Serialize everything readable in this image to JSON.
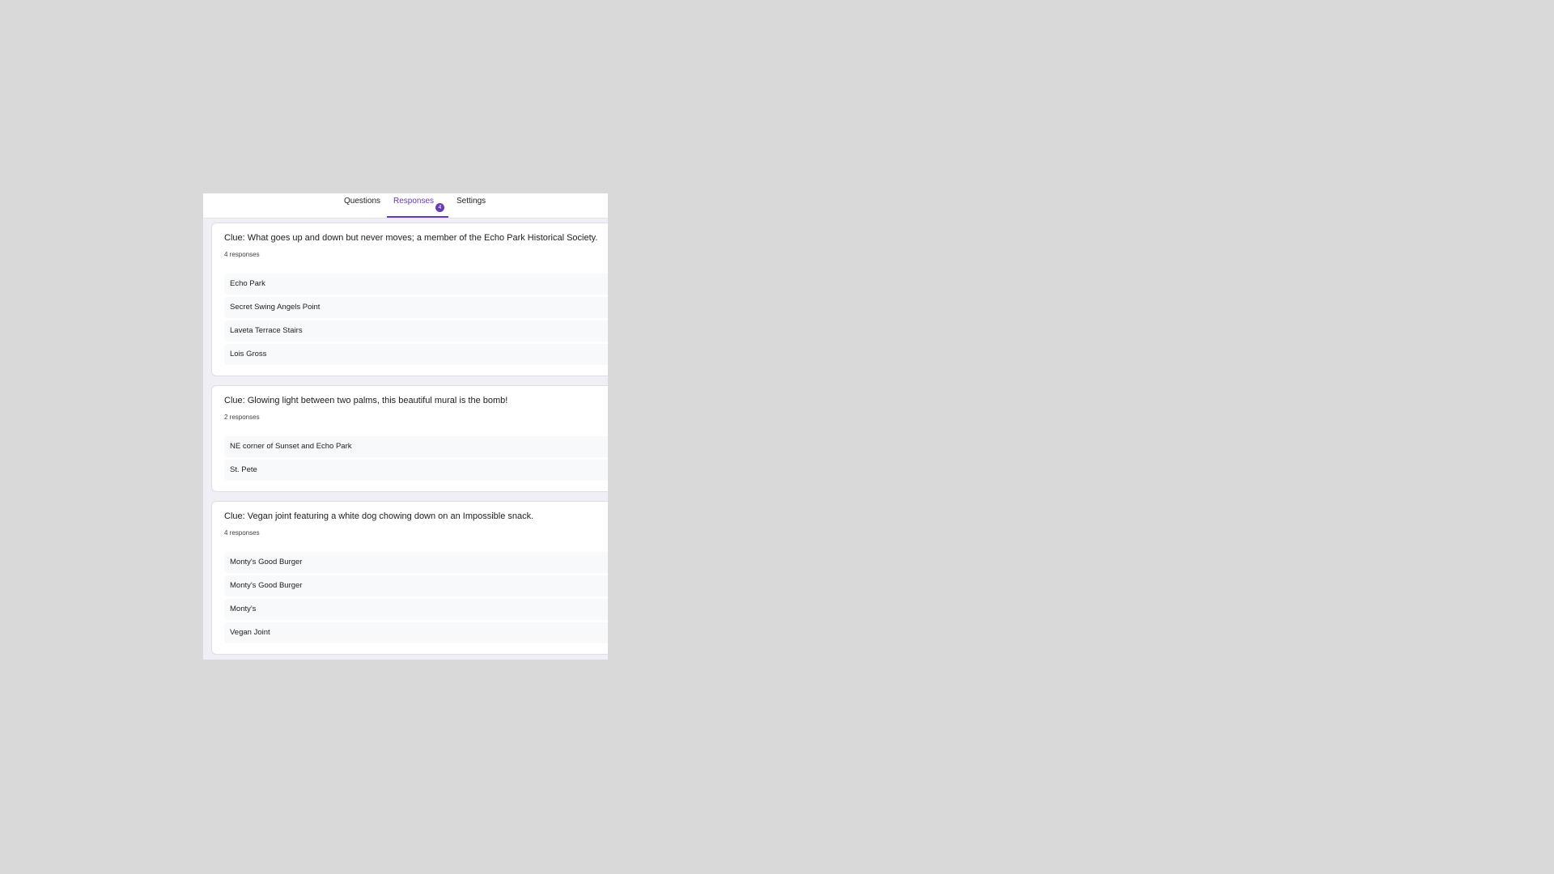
{
  "tabs": {
    "questions": "Questions",
    "responses": "Responses",
    "responses_badge": "4",
    "settings": "Settings"
  },
  "colors": {
    "accent": "#673ab7",
    "background": "#d9d9d9",
    "panel": "#f1eff6"
  },
  "questions": [
    {
      "clue": "Clue: What goes up and down but never moves; a member of the Echo Park Historical Society.",
      "count": "4 responses",
      "answers": [
        "Echo Park",
        "Secret Swing Angels Point",
        "Laveta Terrace Stairs",
        "Lois Gross"
      ]
    },
    {
      "clue": "Clue: Glowing light between two palms, this beautiful mural is the bomb!",
      "count": "2 responses",
      "answers": [
        "NE corner of Sunset and Echo Park",
        "St. Pete"
      ]
    },
    {
      "clue": "Clue: Vegan joint featuring a white dog chowing down on an Impossible snack.",
      "count": "4 responses",
      "answers": [
        "Monty's Good Burger",
        "Monty's Good Burger",
        "Monty's",
        "Vegan Joint"
      ]
    }
  ]
}
